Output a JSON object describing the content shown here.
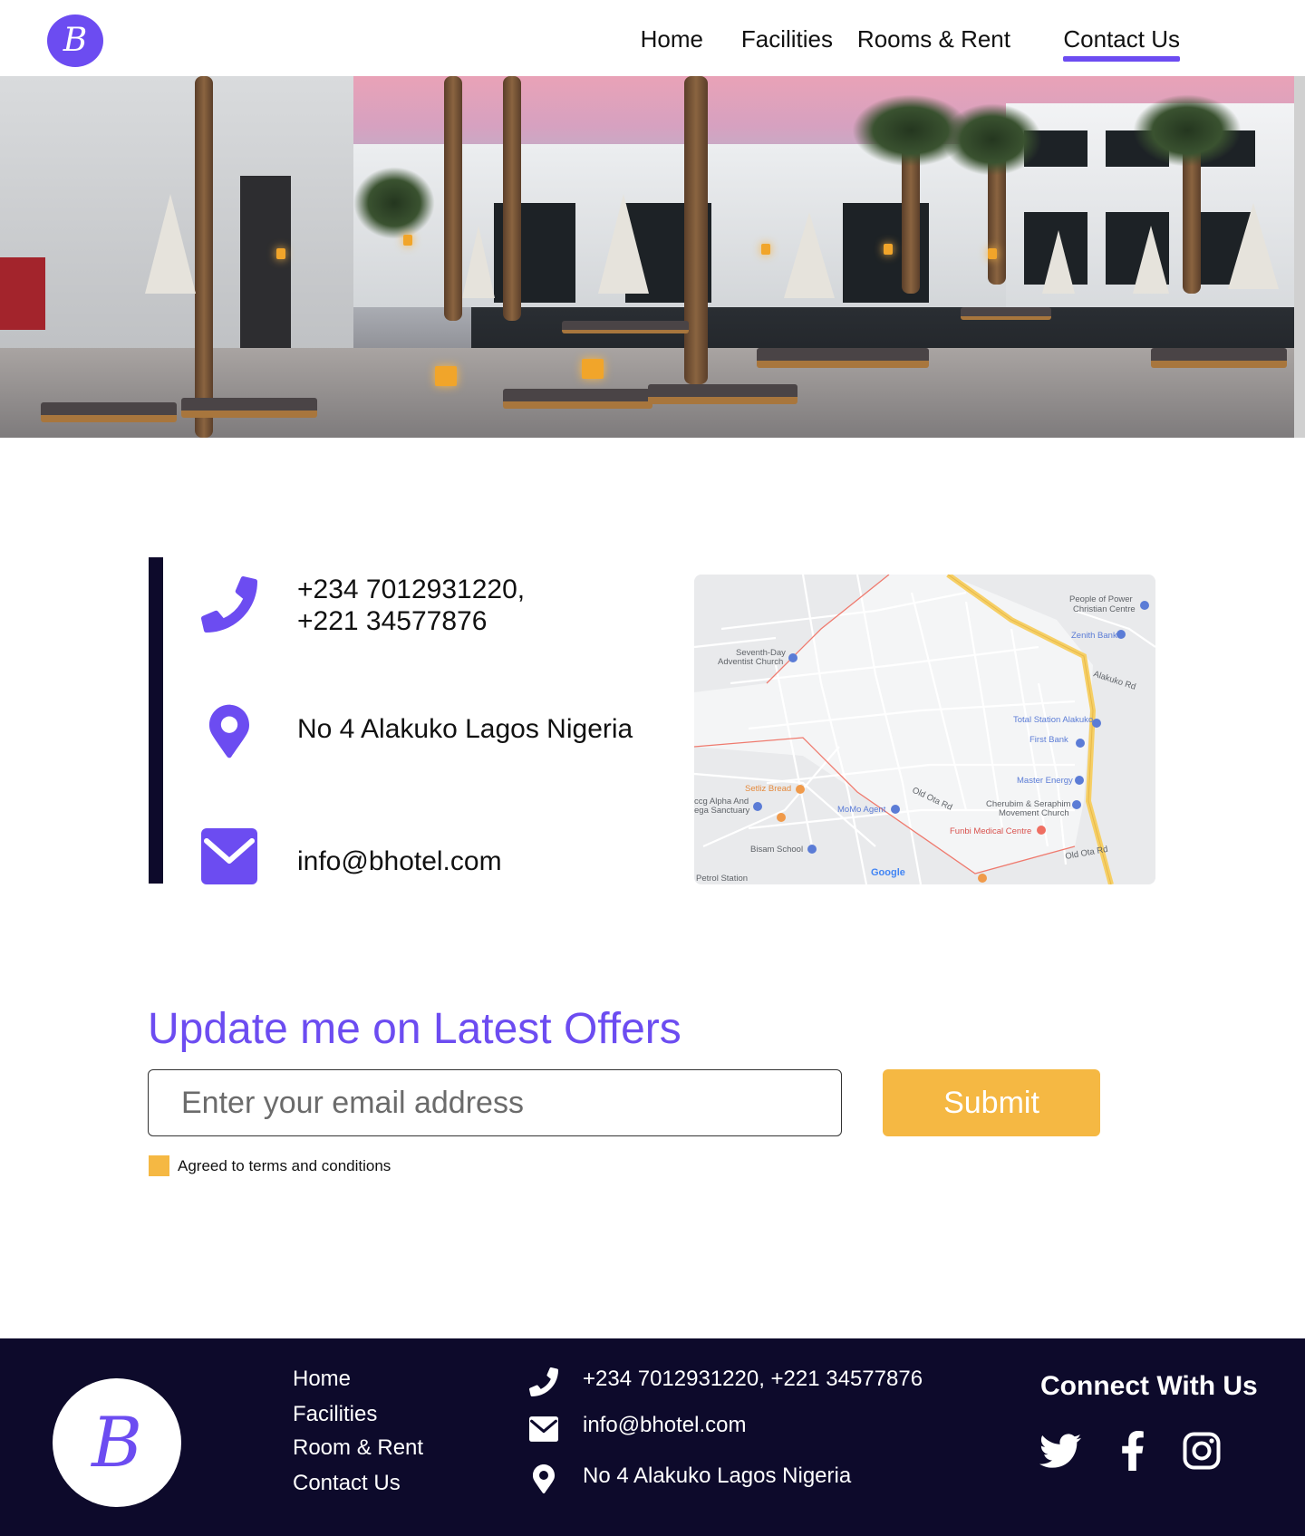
{
  "brand": {
    "logo_letter": "B"
  },
  "nav": {
    "items": [
      {
        "label": "Home"
      },
      {
        "label": "Facilities"
      },
      {
        "label": "Rooms & Rent"
      },
      {
        "label": "Contact Us",
        "active": true
      }
    ]
  },
  "contact": {
    "phone_line1": "+234 7012931220,",
    "phone_line2": "+221 34577876",
    "address": "No 4 Alakuko Lagos Nigeria",
    "email": "info@bhotel.com",
    "icons": [
      "phone-icon",
      "location-pin-icon",
      "mail-icon"
    ]
  },
  "map": {
    "labels": {
      "people_power_1": "People of Power",
      "people_power_2": "Christian Centre",
      "zenith": "Zenith Bank",
      "seventh_day_1": "Seventh-Day",
      "seventh_day_2": "Adventist Church",
      "alakuko_rd": "Alakuko Rd",
      "total": "Total Station Alakuko",
      "first_bank": "First Bank",
      "master_energy": "Master Energy",
      "cherubim_1": "Cherubim & Seraphim",
      "cherubim_2": "Movement Church",
      "funbi": "Funbi Medical Centre",
      "setliz": "Setliz Bread",
      "momo": "MoMo Agent",
      "ccg_1": "ccg Alpha And",
      "ccg_2": "ega Sanctuary",
      "bisam": "Bisam School",
      "petrol": "Petrol Station",
      "old_ota_rd": "Old Ota Rd",
      "google": "Google"
    }
  },
  "offers": {
    "title": "Update me on Latest Offers",
    "email_placeholder": "Enter your email address",
    "submit_label": "Submit",
    "terms_label": "Agreed to terms and conditions",
    "terms_checked": true
  },
  "footer": {
    "logo_letter": "B",
    "links": [
      "Home",
      "Facilities",
      "Room & Rent",
      "Contact Us"
    ],
    "phone": "+234 7012931220, +221 34577876",
    "email": "info@bhotel.com",
    "address": "No 4 Alakuko Lagos Nigeria",
    "connect_title": "Connect With Us",
    "social": [
      "twitter-icon",
      "facebook-icon",
      "instagram-icon"
    ]
  },
  "colors": {
    "accent": "#6c4cf1",
    "navy": "#0d0a2b",
    "submit": "#f5b843"
  }
}
